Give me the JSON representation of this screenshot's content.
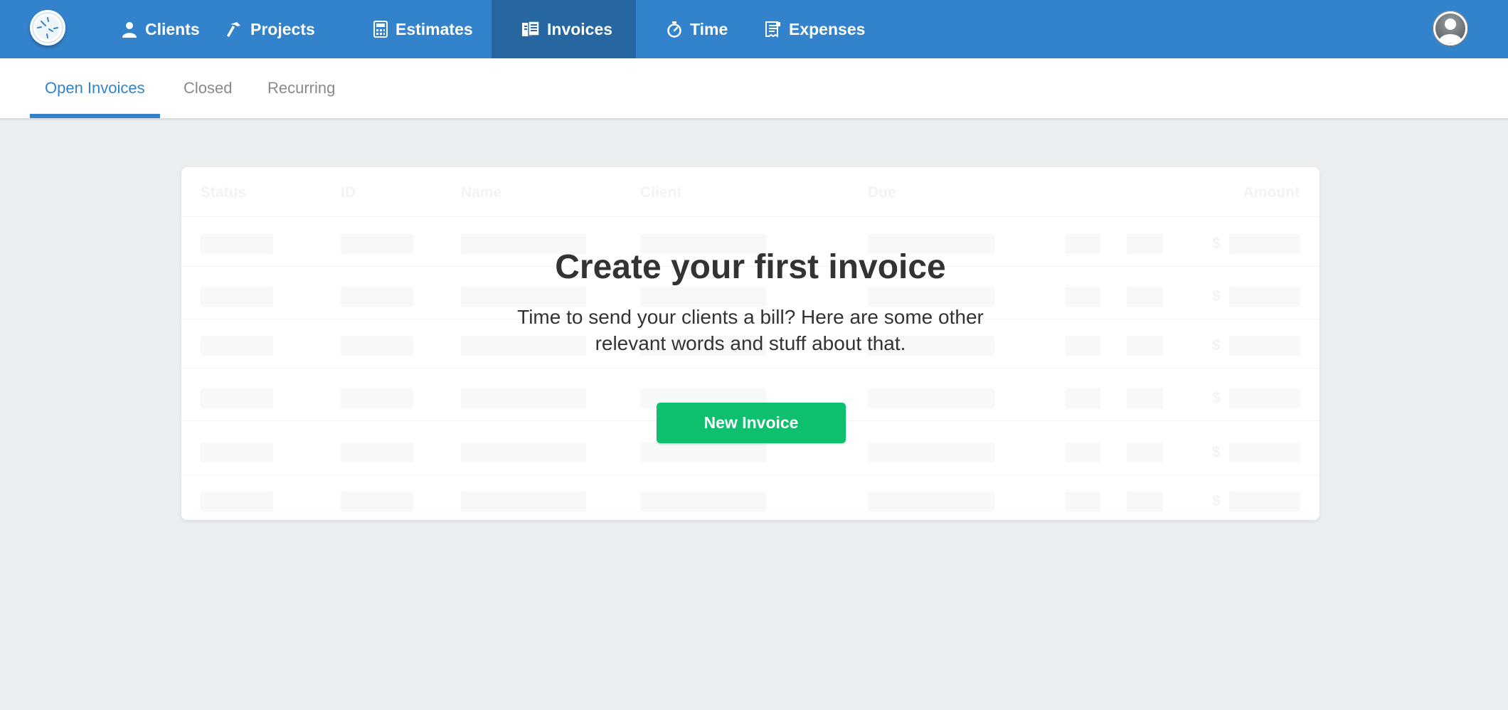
{
  "nav": {
    "items": [
      {
        "label": "Clients",
        "icon": "person-icon"
      },
      {
        "label": "Projects",
        "icon": "hammer-icon"
      },
      {
        "label": "Estimates",
        "icon": "calculator-icon"
      },
      {
        "label": "Invoices",
        "icon": "invoice-icon",
        "active": true
      },
      {
        "label": "Time",
        "icon": "stopwatch-icon"
      },
      {
        "label": "Expenses",
        "icon": "receipt-icon"
      }
    ]
  },
  "subtabs": [
    {
      "label": "Open Invoices",
      "active": true
    },
    {
      "label": "Closed"
    },
    {
      "label": "Recurring"
    }
  ],
  "table": {
    "headers": [
      "Status",
      "ID",
      "Name",
      "Client",
      "Due",
      "Amount"
    ],
    "currency": "$"
  },
  "empty_state": {
    "title": "Create your first invoice",
    "description": "Time to send your clients a bill? Here are some other relevant words and stuff about that.",
    "button": "New Invoice"
  },
  "colors": {
    "brand": "#3283cc",
    "nav_active": "#2767a1",
    "primary_button": "#0ec06e",
    "background": "#eaeef1"
  }
}
